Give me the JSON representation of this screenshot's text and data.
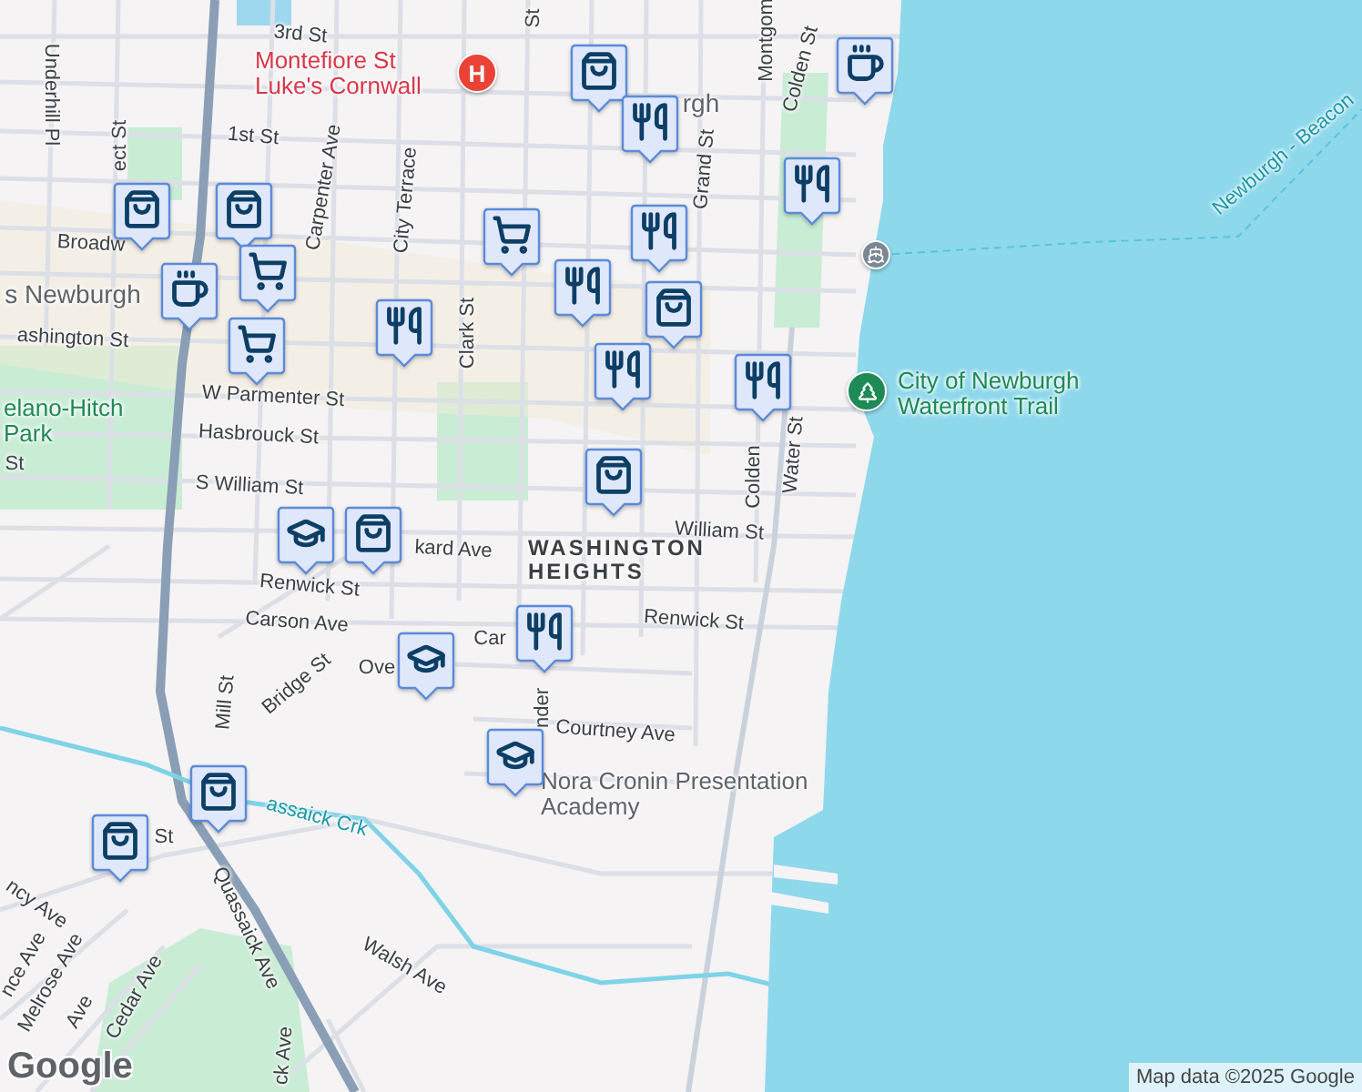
{
  "map": {
    "labels": [
      {
        "text": "3rd St",
        "kind": "street"
      },
      {
        "text": "Montefiore St Luke's Cornwall",
        "kind": "hospital"
      },
      {
        "text": "1st St",
        "kind": "street"
      },
      {
        "text": "Underhill Pl",
        "kind": "street"
      },
      {
        "text": "ect St",
        "kind": "street"
      },
      {
        "text": "Carpenter Ave",
        "kind": "street"
      },
      {
        "text": "City Terrace",
        "kind": "street"
      },
      {
        "text": "Clark St",
        "kind": "street"
      },
      {
        "text": "Broadw",
        "kind": "street"
      },
      {
        "text": "s Newburgh",
        "kind": "area"
      },
      {
        "text": "ashington St",
        "kind": "street"
      },
      {
        "text": "elano-Hitch Park",
        "kind": "park"
      },
      {
        "text": "W Parmenter St",
        "kind": "street"
      },
      {
        "text": "Hasbrouck St",
        "kind": "street"
      },
      {
        "text": "S William St",
        "kind": "street"
      },
      {
        "text": "St",
        "kind": "street"
      },
      {
        "text": "Grand St",
        "kind": "street"
      },
      {
        "text": "Montgom",
        "kind": "street"
      },
      {
        "text": "Colden St",
        "kind": "street"
      },
      {
        "text": "Colden",
        "kind": "street"
      },
      {
        "text": "Water St",
        "kind": "street"
      },
      {
        "text": "City of Newburgh Waterfront Trail",
        "kind": "trail"
      },
      {
        "text": "Newburgh - Beacon",
        "kind": "water"
      },
      {
        "text": "WASHINGTON HEIGHTS",
        "kind": "neighborhood"
      },
      {
        "text": "William St",
        "kind": "street"
      },
      {
        "text": "kard Ave",
        "kind": "street"
      },
      {
        "text": "Renwick St",
        "kind": "street"
      },
      {
        "text": "Carson Ave",
        "kind": "street"
      },
      {
        "text": "Renwick St",
        "kind": "street"
      },
      {
        "text": "Car",
        "kind": "street"
      },
      {
        "text": "Ove",
        "kind": "street"
      },
      {
        "text": "Bridge St",
        "kind": "street"
      },
      {
        "text": "Mill St",
        "kind": "street"
      },
      {
        "text": "nder",
        "kind": "street"
      },
      {
        "text": "Courtney Ave",
        "kind": "street"
      },
      {
        "text": "Nora Cronin Presentation Academy",
        "kind": "poi"
      },
      {
        "text": "assaick Crk",
        "kind": "water"
      },
      {
        "text": "St",
        "kind": "street"
      },
      {
        "text": "Quassaick Ave",
        "kind": "street"
      },
      {
        "text": "Walsh Ave",
        "kind": "street"
      },
      {
        "text": "ncy Ave",
        "kind": "street"
      },
      {
        "text": "nce Ave",
        "kind": "street"
      },
      {
        "text": "Melrose Ave",
        "kind": "street"
      },
      {
        "text": "Ave",
        "kind": "street"
      },
      {
        "text": "Cedar Ave",
        "kind": "street"
      },
      {
        "text": "ck Ave",
        "kind": "street"
      },
      {
        "text": "rgh",
        "kind": "area"
      },
      {
        "text": "St",
        "kind": "street"
      }
    ],
    "markers": [
      {
        "kind": "hospital",
        "text": "H"
      },
      {
        "kind": "ferry"
      },
      {
        "kind": "park"
      }
    ],
    "pins": [
      {
        "kind": "shopping"
      },
      {
        "kind": "shopping"
      },
      {
        "kind": "shopping"
      },
      {
        "kind": "shopping"
      },
      {
        "kind": "shopping"
      },
      {
        "kind": "shopping"
      },
      {
        "kind": "shopping"
      },
      {
        "kind": "shopping"
      },
      {
        "kind": "restaurant"
      },
      {
        "kind": "restaurant"
      },
      {
        "kind": "restaurant"
      },
      {
        "kind": "restaurant"
      },
      {
        "kind": "restaurant"
      },
      {
        "kind": "restaurant"
      },
      {
        "kind": "restaurant"
      },
      {
        "kind": "restaurant"
      },
      {
        "kind": "cafe"
      },
      {
        "kind": "cafe"
      },
      {
        "kind": "grocery"
      },
      {
        "kind": "grocery"
      },
      {
        "kind": "grocery"
      },
      {
        "kind": "school"
      },
      {
        "kind": "school"
      },
      {
        "kind": "school"
      }
    ]
  },
  "attribution": "Map data ©2025 Google",
  "logo": "Google"
}
